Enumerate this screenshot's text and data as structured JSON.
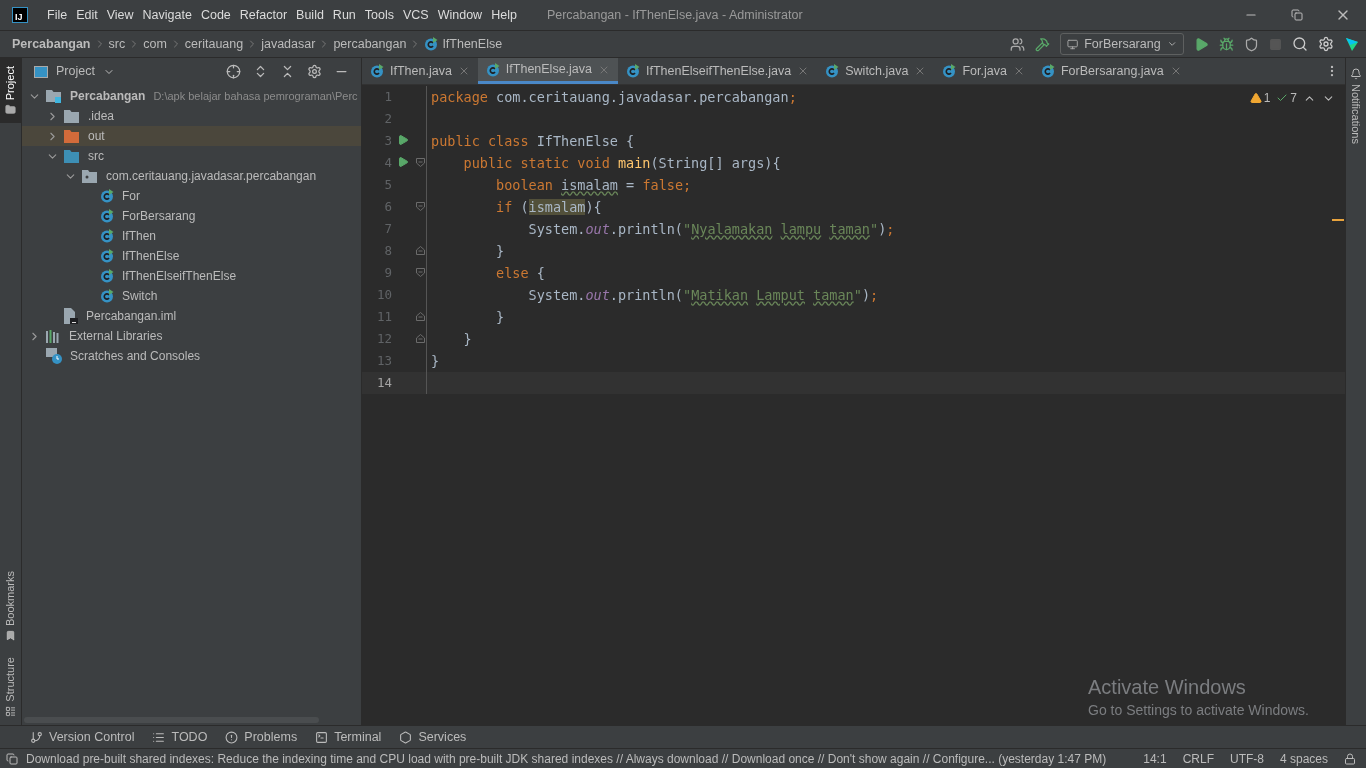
{
  "title_bar": {
    "logo_text": "IJ",
    "menu": [
      "File",
      "Edit",
      "View",
      "Navigate",
      "Code",
      "Refactor",
      "Build",
      "Run",
      "Tools",
      "VCS",
      "Window",
      "Help"
    ],
    "title": "Percabangan - IfThenElse.java - Administrator"
  },
  "nav_bar": {
    "breadcrumbs": [
      "Percabangan",
      "src",
      "com",
      "ceritauang",
      "javadasar",
      "percabangan",
      "IfThenElse"
    ],
    "run_config": "ForBersarang"
  },
  "left_stripe": [
    {
      "label": "Project",
      "selected": true
    },
    {
      "label": "Bookmarks",
      "selected": false
    },
    {
      "label": "Structure",
      "selected": false
    }
  ],
  "right_stripe": {
    "label": "Notifications"
  },
  "project_panel": {
    "title": "Project",
    "tree": [
      {
        "kind": "module",
        "label": "Percabangan",
        "path": "D:\\apk belajar bahasa pemrograman\\Perc",
        "expanded": true,
        "selected": false,
        "children": [
          {
            "kind": "folder",
            "label": ".idea",
            "expanded": false,
            "selected": false
          },
          {
            "kind": "excluded",
            "label": "out",
            "expanded": false,
            "selected": true
          },
          {
            "kind": "source",
            "label": "src",
            "expanded": true,
            "selected": false,
            "children": [
              {
                "kind": "package",
                "label": "com.ceritauang.javadasar.percabangan",
                "expanded": true,
                "selected": false,
                "children": [
                  {
                    "kind": "class",
                    "label": "For",
                    "selected": false
                  },
                  {
                    "kind": "class",
                    "label": "ForBersarang",
                    "selected": false
                  },
                  {
                    "kind": "class",
                    "label": "IfThen",
                    "selected": false
                  },
                  {
                    "kind": "class",
                    "label": "IfThenElse",
                    "selected": false
                  },
                  {
                    "kind": "class",
                    "label": "IfThenElseifThenElse",
                    "selected": false
                  },
                  {
                    "kind": "class",
                    "label": "Switch",
                    "selected": false
                  }
                ]
              }
            ]
          },
          {
            "kind": "file",
            "label": "Percabangan.iml",
            "selected": false
          }
        ]
      },
      {
        "kind": "libraries",
        "label": "External Libraries",
        "expanded": false,
        "selected": false
      },
      {
        "kind": "scratches",
        "label": "Scratches and Consoles",
        "selected": false
      }
    ]
  },
  "editor": {
    "tabs": [
      {
        "label": "IfThen.java",
        "selected": false
      },
      {
        "label": "IfThenElse.java",
        "selected": true
      },
      {
        "label": "IfThenElseifThenElse.java",
        "selected": false
      },
      {
        "label": "Switch.java",
        "selected": false
      },
      {
        "label": "For.java",
        "selected": false
      },
      {
        "label": "ForBersarang.java",
        "selected": false
      }
    ],
    "warnings": "1",
    "checks": "7",
    "lines": [
      {
        "number": "1",
        "run": false,
        "fold_start": false,
        "fold_end": false,
        "current": false,
        "tokens": [
          {
            "kind": "keyword",
            "t": "package "
          },
          {
            "kind": "text",
            "t": "com.ceritauang.javadasar.percabangan"
          },
          {
            "kind": "keyword",
            "t": ";"
          }
        ]
      },
      {
        "number": "2",
        "run": false,
        "fold_start": false,
        "fold_end": false,
        "current": false
      },
      {
        "number": "3",
        "run": true,
        "fold_start": false,
        "fold_end": false,
        "current": false,
        "tokens": [
          {
            "kind": "keyword",
            "t": "public class "
          },
          {
            "kind": "text",
            "t": "IfThenElse {"
          }
        ]
      },
      {
        "number": "4",
        "run": true,
        "fold_start": true,
        "fold_end": false,
        "current": false,
        "tokens": [
          {
            "kind": "keyword",
            "t": "    public static void "
          },
          {
            "kind": "method",
            "t": "main"
          },
          {
            "kind": "text",
            "t": "(String[] args){"
          }
        ]
      },
      {
        "number": "5",
        "run": false,
        "fold_start": false,
        "fold_end": false,
        "current": false,
        "tokens": [
          {
            "kind": "keyword",
            "t": "        boolean "
          },
          {
            "kind": "typo",
            "t": "ismalam"
          },
          {
            "kind": "text",
            "t": " = "
          },
          {
            "kind": "keyword",
            "t": "false;"
          }
        ]
      },
      {
        "number": "6",
        "run": false,
        "fold_start": true,
        "fold_end": false,
        "current": false,
        "tokens": [
          {
            "kind": "keyword",
            "t": "        if "
          },
          {
            "kind": "text",
            "t": "("
          },
          {
            "kind": "match",
            "t": "ismalam"
          },
          {
            "kind": "text",
            "t": "){"
          }
        ]
      },
      {
        "number": "7",
        "run": false,
        "fold_start": false,
        "fold_end": false,
        "current": false,
        "tokens": [
          {
            "kind": "text",
            "t": "            System."
          },
          {
            "kind": "static",
            "t": "out"
          },
          {
            "kind": "text",
            "t": ".println("
          },
          {
            "kind": "string",
            "t": "\""
          },
          {
            "kind": "string_typo",
            "t": "Nyalamakan"
          },
          {
            "kind": "string_typo",
            "t": " lampu"
          },
          {
            "kind": "string_typo",
            "t": " taman"
          },
          {
            "kind": "string",
            "t": "\""
          },
          {
            "kind": "text",
            "t": ")"
          },
          {
            "kind": "keyword",
            "t": ";"
          }
        ]
      },
      {
        "number": "8",
        "run": false,
        "fold_start": false,
        "fold_end": true,
        "current": false,
        "tokens": [
          {
            "kind": "text",
            "t": "        }"
          }
        ]
      },
      {
        "number": "9",
        "run": false,
        "fold_start": true,
        "fold_end": false,
        "current": false,
        "tokens": [
          {
            "kind": "keyword",
            "t": "        else "
          },
          {
            "kind": "text",
            "t": "{"
          }
        ]
      },
      {
        "number": "10",
        "run": false,
        "fold_start": false,
        "fold_end": false,
        "current": false,
        "tokens": [
          {
            "kind": "text",
            "t": "            System."
          },
          {
            "kind": "static",
            "t": "out"
          },
          {
            "kind": "text",
            "t": ".println("
          },
          {
            "kind": "string",
            "t": "\""
          },
          {
            "kind": "string_typo",
            "t": "Matikan"
          },
          {
            "kind": "string_typo",
            "t": " Lamput"
          },
          {
            "kind": "string_typo",
            "t": " taman"
          },
          {
            "kind": "string",
            "t": "\""
          },
          {
            "kind": "text",
            "t": ")"
          },
          {
            "kind": "keyword",
            "t": ";"
          }
        ]
      },
      {
        "number": "11",
        "run": false,
        "fold_start": false,
        "fold_end": true,
        "current": false,
        "tokens": [
          {
            "kind": "text",
            "t": "        }"
          }
        ]
      },
      {
        "number": "12",
        "run": false,
        "fold_start": false,
        "fold_end": true,
        "current": false,
        "tokens": [
          {
            "kind": "text",
            "t": "    }"
          }
        ]
      },
      {
        "number": "13",
        "run": false,
        "fold_start": false,
        "fold_end": false,
        "current": false,
        "tokens": [
          {
            "kind": "text",
            "t": "}"
          }
        ]
      },
      {
        "number": "14",
        "run": false,
        "fold_start": false,
        "fold_end": false,
        "current": true
      }
    ]
  },
  "os_overlay": {
    "title": "Activate Windows",
    "subtitle": "Go to Settings to activate Windows."
  },
  "tool_windows": [
    "Version Control",
    "TODO",
    "Problems",
    "Terminal",
    "Services"
  ],
  "status_bar": {
    "message": "Download pre-built shared indexes: Reduce the indexing time and CPU load with pre-built JDK shared indexes // Always download // Download once // Don't show again // Configure... (yesterday 1:47 PM)",
    "position": "14:1",
    "line_separator": "CRLF",
    "encoding": "UTF-8",
    "indent": "4 spaces"
  }
}
